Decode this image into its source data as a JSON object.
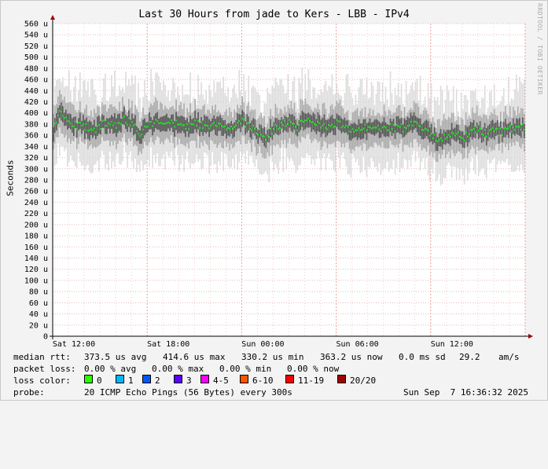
{
  "title": "Last 30 Hours from jade to Kers - LBB - IPv4",
  "vertical_label": "Seconds",
  "watermark": "RRDTOOL / TOBI OETIKER",
  "chart_data": {
    "type": "line",
    "title": "Last 30 Hours from jade to Kers - LBB - IPv4",
    "ylabel": "Seconds",
    "y_unit": "u",
    "ylim": [
      0,
      560
    ],
    "y_ticks": [
      "0",
      "20 u",
      "40 u",
      "60 u",
      "80 u",
      "100 u",
      "120 u",
      "140 u",
      "160 u",
      "180 u",
      "200 u",
      "220 u",
      "240 u",
      "260 u",
      "280 u",
      "300 u",
      "320 u",
      "340 u",
      "360 u",
      "380 u",
      "400 u",
      "420 u",
      "440 u",
      "460 u",
      "480 u",
      "500 u",
      "520 u",
      "540 u",
      "560 u"
    ],
    "x_ticks": [
      "Sat 12:00",
      "Sat 18:00",
      "Sun 00:00",
      "Sun 06:00",
      "Sun 12:00"
    ],
    "grid": true,
    "series": [
      {
        "name": "median rtt",
        "color": "#22dd22",
        "x_hours_from_sat_12": [
          0.0,
          0.5,
          1.0,
          1.5,
          2.0,
          2.5,
          3.0,
          3.5,
          4.0,
          4.5,
          5.0,
          5.5,
          6.0,
          6.5,
          7.0,
          7.5,
          8.0,
          8.5,
          9.0,
          9.5,
          10.0,
          10.5,
          11.0,
          11.5,
          12.0,
          12.5,
          13.0,
          13.5,
          14.0,
          14.5,
          15.0,
          15.5,
          16.0,
          16.5,
          17.0,
          17.5,
          18.0,
          18.5,
          19.0,
          19.5,
          20.0,
          20.5,
          21.0,
          21.5,
          22.0,
          22.5,
          23.0,
          23.5,
          24.0,
          24.5,
          25.0,
          25.5,
          26.0,
          26.5,
          27.0,
          27.5,
          28.0,
          28.5,
          29.0,
          29.5
        ],
        "values": [
          370,
          405,
          385,
          378,
          375,
          368,
          378,
          382,
          375,
          388,
          382,
          365,
          378,
          383,
          380,
          382,
          378,
          375,
          385,
          375,
          380,
          378,
          372,
          380,
          385,
          378,
          368,
          358,
          372,
          378,
          382,
          375,
          388,
          382,
          375,
          378,
          382,
          375,
          368,
          372,
          375,
          378,
          370,
          375,
          372,
          375,
          382,
          368,
          360,
          350,
          358,
          362,
          355,
          365,
          370,
          362,
          368,
          365,
          372,
          375
        ]
      }
    ]
  },
  "legend": {
    "median_rtt": {
      "label": "median rtt:",
      "avg": "373.5 us avg",
      "max": "414.6 us max",
      "min": "330.2 us min",
      "now": "363.2 us now",
      "sd": "0.0 ms sd",
      "am": "29.2",
      "am_unit": "am/s"
    },
    "packet_loss": {
      "label": "packet loss:",
      "avg": "0.00 % avg",
      "max": "0.00 % max",
      "min": "0.00 % min",
      "now": "0.00 % now"
    },
    "loss_color": {
      "label": "loss color:",
      "items": [
        {
          "label": "0",
          "color": "#26ff00"
        },
        {
          "label": "1",
          "color": "#00b8ff"
        },
        {
          "label": "2",
          "color": "#0059ff"
        },
        {
          "label": "3",
          "color": "#5e00ff"
        },
        {
          "label": "4-5",
          "color": "#ff00ff"
        },
        {
          "label": "6-10",
          "color": "#ff5500"
        },
        {
          "label": "11-19",
          "color": "#ff0000"
        },
        {
          "label": "20/20",
          "color": "#a10000"
        }
      ]
    },
    "probe": {
      "label": "probe:",
      "text": "20 ICMP Echo Pings (56 Bytes) every 300s",
      "timestamp": "Sun Sep  7 16:36:32 2025"
    }
  }
}
